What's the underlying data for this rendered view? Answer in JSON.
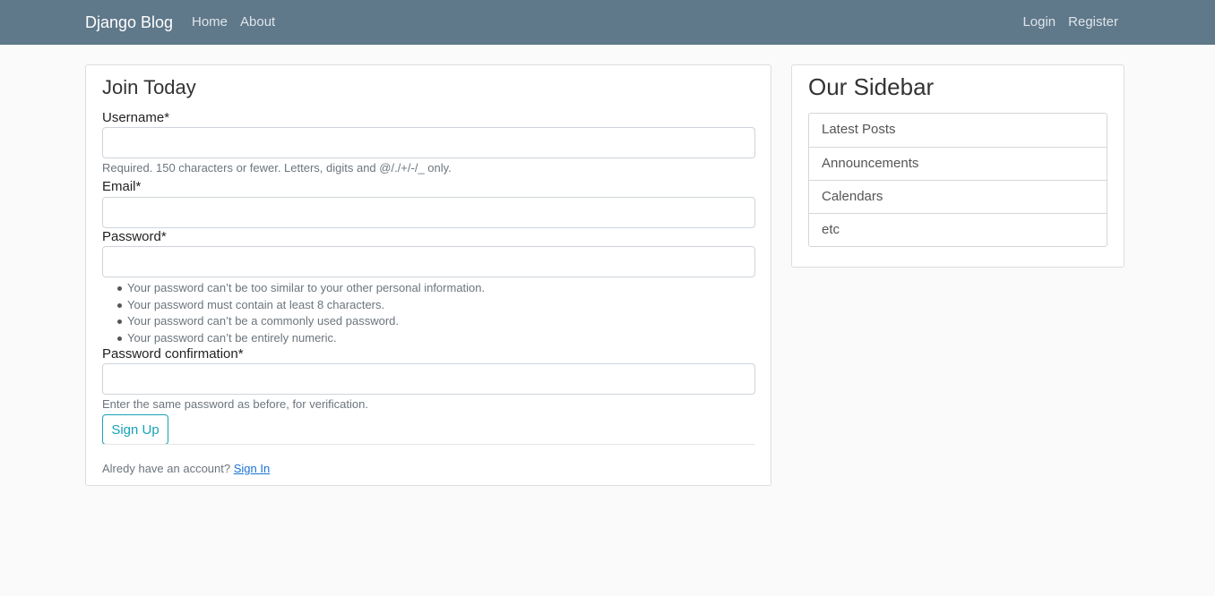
{
  "navbar": {
    "brand": "Django Blog",
    "left_links": [
      "Home",
      "About"
    ],
    "right_links": [
      "Login",
      "Register"
    ]
  },
  "form": {
    "title": "Join Today",
    "username_label": "Username*",
    "username_value": "",
    "username_help": "Required. 150 characters or fewer. Letters, digits and @/./+/-/_ only.",
    "email_label": "Email*",
    "email_value": "",
    "password_label": "Password*",
    "password_value": "",
    "password_help": [
      "Your password can’t be too similar to your other personal information.",
      "Your password must contain at least 8 characters.",
      "Your password can’t be a commonly used password.",
      "Your password can’t be entirely numeric."
    ],
    "password_confirm_label": "Password confirmation*",
    "password_confirm_value": "",
    "password_confirm_help": "Enter the same password as before, for verification.",
    "submit_label": "Sign Up",
    "account_prompt": "Alredy have an account?",
    "signin_link": "Sign In"
  },
  "sidebar": {
    "title": "Our Sidebar",
    "items": [
      "Latest Posts",
      "Announcements",
      "Calendars",
      "etc"
    ]
  },
  "colors": {
    "navbar": "#5f788a",
    "page_background": "#fafafa",
    "button_accent": "#17a2b8",
    "link": "#1a73d9"
  }
}
